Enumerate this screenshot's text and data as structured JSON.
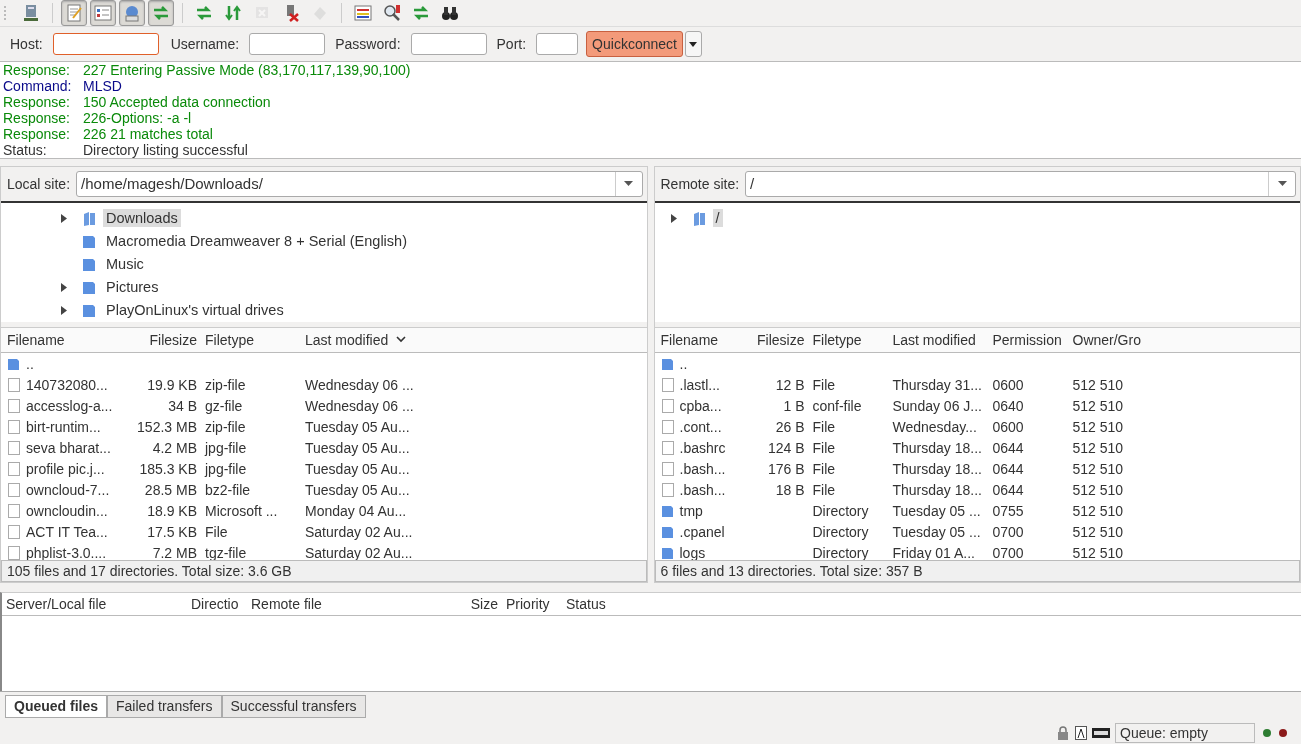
{
  "toolbar": [
    {
      "kind": "server",
      "pressed": false,
      "disabled": false
    },
    {
      "kind": "log",
      "pressed": true,
      "disabled": false
    },
    {
      "kind": "tree",
      "pressed": true,
      "disabled": false
    },
    {
      "kind": "globe",
      "pressed": true,
      "disabled": false
    },
    {
      "kind": "transfer",
      "pressed": true,
      "disabled": false
    },
    {
      "kind": "refresh",
      "pressed": false,
      "disabled": false
    },
    {
      "kind": "process",
      "pressed": false,
      "disabled": false
    },
    {
      "kind": "cancel",
      "pressed": false,
      "disabled": true
    },
    {
      "kind": "disconnect",
      "pressed": false,
      "disabled": false
    },
    {
      "kind": "reconnect",
      "pressed": false,
      "disabled": true
    },
    {
      "kind": "filter",
      "pressed": false,
      "disabled": false
    },
    {
      "kind": "compare",
      "pressed": false,
      "disabled": false
    },
    {
      "kind": "sync",
      "pressed": false,
      "disabled": false
    },
    {
      "kind": "binoculars",
      "pressed": false,
      "disabled": false
    }
  ],
  "quickconnect": {
    "host_label": "Host:",
    "username_label": "Username:",
    "password_label": "Password:",
    "port_label": "Port:",
    "button": "Quickconnect"
  },
  "log": [
    {
      "kind": "response",
      "label": "Response:",
      "text": "227 Entering Passive Mode (83,170,117,139,90,100)"
    },
    {
      "kind": "command",
      "label": "Command:",
      "text": "MLSD"
    },
    {
      "kind": "response",
      "label": "Response:",
      "text": "150 Accepted data connection"
    },
    {
      "kind": "response",
      "label": "Response:",
      "text": "226-Options: -a -l"
    },
    {
      "kind": "response",
      "label": "Response:",
      "text": "226 21 matches total"
    },
    {
      "kind": "status",
      "label": "Status:",
      "text": "Directory listing successful"
    }
  ],
  "local": {
    "site_label": "Local site:",
    "path": "/home/magesh/Downloads/",
    "tree": [
      {
        "name": "Downloads",
        "expandable": true,
        "selected": true,
        "kind": "open"
      },
      {
        "name": "Macromedia Dreamweaver 8 + Serial (English)",
        "expandable": false,
        "selected": false,
        "kind": "folder"
      },
      {
        "name": "Music",
        "expandable": false,
        "selected": false,
        "kind": "folder"
      },
      {
        "name": "Pictures",
        "expandable": true,
        "selected": false,
        "kind": "folder"
      },
      {
        "name": "PlayOnLinux's virtual drives",
        "expandable": true,
        "selected": false,
        "kind": "folder"
      }
    ],
    "columns": [
      {
        "label": "Filename",
        "sorted": false
      },
      {
        "label": "Filesize",
        "sorted": false
      },
      {
        "label": "Filetype",
        "sorted": false
      },
      {
        "label": "Last modified",
        "sorted": true
      }
    ],
    "rows": [
      {
        "kind": "dir",
        "cells": [
          ".."
        ]
      },
      {
        "kind": "file",
        "cells": [
          "140732080...",
          "19.9 KB",
          "zip-file",
          "Wednesday 06 ..."
        ]
      },
      {
        "kind": "file",
        "cells": [
          "accesslog-a...",
          "34 B",
          "gz-file",
          "Wednesday 06 ..."
        ]
      },
      {
        "kind": "file",
        "cells": [
          "birt-runtim...",
          "152.3 MB",
          "zip-file",
          "Tuesday 05 Au..."
        ]
      },
      {
        "kind": "file",
        "cells": [
          "seva bharat...",
          "4.2 MB",
          "jpg-file",
          "Tuesday 05 Au..."
        ]
      },
      {
        "kind": "file",
        "cells": [
          "profile pic.j...",
          "185.3 KB",
          "jpg-file",
          "Tuesday 05 Au..."
        ]
      },
      {
        "kind": "file",
        "cells": [
          "owncloud-7...",
          "28.5 MB",
          "bz2-file",
          "Tuesday 05 Au..."
        ]
      },
      {
        "kind": "file",
        "cells": [
          "owncloudin...",
          "18.9 KB",
          "Microsoft ...",
          "Monday 04 Au..."
        ]
      },
      {
        "kind": "file",
        "cells": [
          "ACT IT Tea...",
          "17.5 KB",
          "File",
          "Saturday 02 Au..."
        ]
      },
      {
        "kind": "file",
        "cells": [
          "phplist-3.0....",
          "7.2 MB",
          "tgz-file",
          "Saturday 02 Au..."
        ]
      }
    ],
    "status": "105 files and 17 directories. Total size: 3.6 GB"
  },
  "remote": {
    "site_label": "Remote site:",
    "path": "/",
    "tree": [
      {
        "name": "/",
        "expandable": true,
        "selected": true,
        "kind": "open"
      }
    ],
    "columns": [
      {
        "label": "Filename"
      },
      {
        "label": "Filesize"
      },
      {
        "label": "Filetype"
      },
      {
        "label": "Last modified"
      },
      {
        "label": "Permission"
      },
      {
        "label": "Owner/Gro"
      }
    ],
    "rows": [
      {
        "kind": "dir",
        "cells": [
          ".."
        ]
      },
      {
        "kind": "file",
        "cells": [
          ".lastl...",
          "12 B",
          "File",
          "Thursday 31...",
          "0600",
          "512 510"
        ]
      },
      {
        "kind": "file",
        "cells": [
          "cpba...",
          "1 B",
          "conf-file",
          "Sunday 06 J...",
          "0640",
          "512 510"
        ]
      },
      {
        "kind": "file",
        "cells": [
          ".cont...",
          "26 B",
          "File",
          "Wednesday...",
          "0600",
          "512 510"
        ]
      },
      {
        "kind": "file",
        "cells": [
          ".bashrc",
          "124 B",
          "File",
          "Thursday 18...",
          "0644",
          "512 510"
        ]
      },
      {
        "kind": "file",
        "cells": [
          ".bash...",
          "176 B",
          "File",
          "Thursday 18...",
          "0644",
          "512 510"
        ]
      },
      {
        "kind": "file",
        "cells": [
          ".bash...",
          "18 B",
          "File",
          "Thursday 18...",
          "0644",
          "512 510"
        ]
      },
      {
        "kind": "dir",
        "cells": [
          "tmp",
          "",
          "Directory",
          "Tuesday 05 ...",
          "0755",
          "512 510"
        ]
      },
      {
        "kind": "dir",
        "cells": [
          ".cpanel",
          "",
          "Directory",
          "Tuesday 05 ...",
          "0700",
          "512 510"
        ]
      },
      {
        "kind": "dir",
        "cells": [
          "logs",
          "",
          "Directory",
          "Friday 01 A...",
          "0700",
          "512 510"
        ]
      }
    ],
    "status": "6 files and 13 directories. Total size: 357 B"
  },
  "queue": {
    "columns": [
      "Server/Local file",
      "Directio",
      "Remote file",
      "Size",
      "Priority",
      "Status"
    ],
    "tabs": [
      {
        "label": "Queued files",
        "selected": true
      },
      {
        "label": "Failed transfers",
        "selected": false
      },
      {
        "label": "Successful transfers",
        "selected": false
      }
    ]
  },
  "status_bar": {
    "queue": "Queue: empty",
    "lights": [
      {
        "color": "#2e7d32"
      },
      {
        "color": "#8b1a1a"
      }
    ]
  }
}
